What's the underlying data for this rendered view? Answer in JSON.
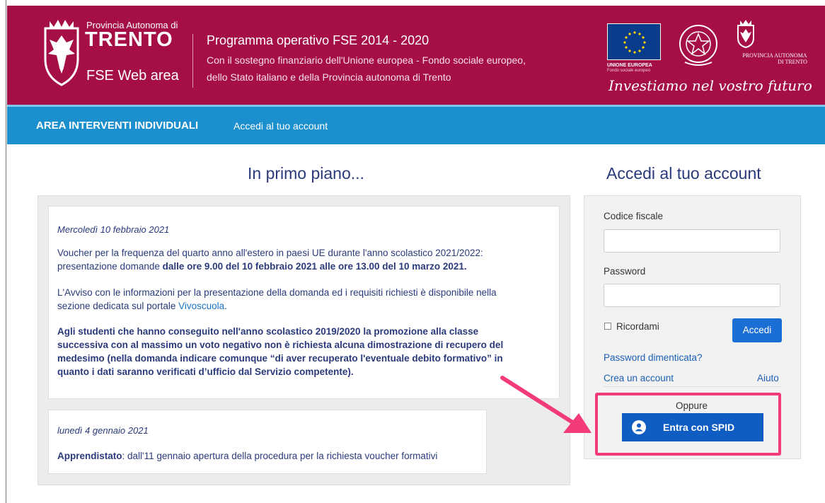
{
  "header": {
    "province_small": "Provincia Autonoma di",
    "province_big": "TRENTO",
    "web_area": "FSE Web area",
    "program_title": "Programma operativo FSE 2014 - 2020",
    "program_line1": "Con il sostegno finanziario dell'Unione europea - Fondo sociale europeo,",
    "program_line2": "dello Stato italiano e della Provincia autonoma di Trento",
    "eu_label": "UNIONE EUROPEA",
    "eu_sub": "Fondo sociale europeo",
    "pat_label1": "PROVINCIA AUTONOMA",
    "pat_label2": "DI TRENTO",
    "motto": "Investiamo nel vostro futuro",
    "brand_color": "#a50f45"
  },
  "nav": {
    "title": "AREA INTERVENTI INDIVIDUALI",
    "subtitle": "Accedi al tuo account",
    "color": "#1c8fcf"
  },
  "news": {
    "heading": "In primo piano...",
    "items": [
      {
        "date": "Mercoledì 10 febbraio 2021",
        "p1_a": "Voucher per la frequenza del quarto anno all'estero in paesi UE durante l'anno scolastico 2021/2022:",
        "p1_b": "presentazione domande ",
        "p1_bold": "dalle ore 9.00 del 10 febbraio 2021 alle ore 13.00 del 10 marzo 2021.",
        "p2_a": "L'Avviso con le informazioni per la presentazione della domanda ed i requisiti richiesti è disponibile nella",
        "p2_b": "sezione dedicata sul portale ",
        "p2_link": "Vivoscuola",
        "p2_end": ".",
        "p3_l1": "Agli studenti che hanno conseguito nell'anno scolastico 2019/2020 la promozione alla classe",
        "p3_l2": "successiva con al massimo un voto negativo non è richiesta alcuna dimostrazione di recupero del",
        "p3_l3": "medesimo (nella domanda indicare comunque “di aver recuperato l'eventuale debito formativo” in",
        "p3_l4": "quanto i dati saranno verificati d’ufficio dal Servizio competente)."
      },
      {
        "date": "lunedì 4 gennaio 2021",
        "bold": "Apprendistato",
        "text": ": dall'11 gennaio apertura della procedura per la richiesta voucher formativi"
      }
    ]
  },
  "login": {
    "heading": "Accedi al tuo account",
    "codice_label": "Codice fiscale",
    "codice_value": "",
    "password_label": "Password",
    "password_value": "",
    "remember_label": "Ricordami",
    "submit_label": "Accedi",
    "forgot_link": "Password dimenticata?",
    "create_link": "Crea un account",
    "help_link": "Aiuto",
    "or_label": "Oppure",
    "spid_label": "Entra con SPID",
    "spid_color": "#0f5cc2",
    "highlight_color": "#f33a7b"
  }
}
